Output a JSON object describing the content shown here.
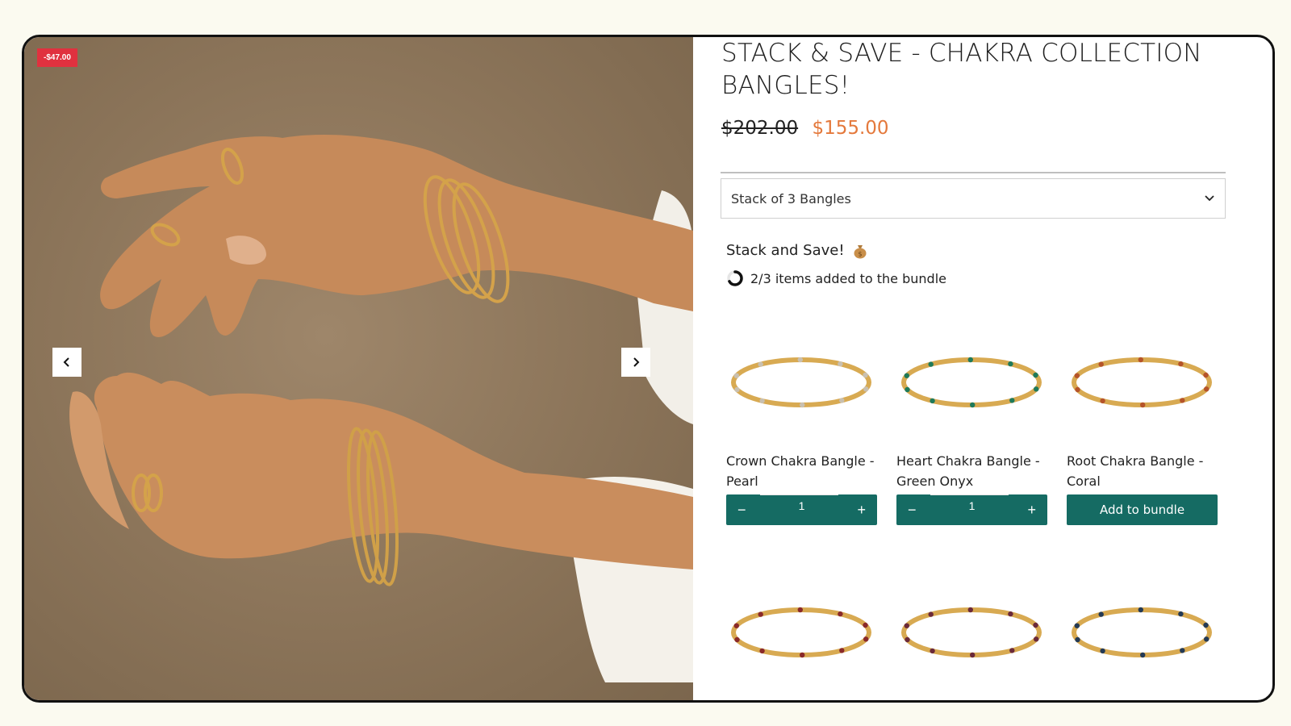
{
  "gallery": {
    "discount_badge": "-$47.00",
    "prev_icon": "chevron-left-icon",
    "next_icon": "chevron-right-icon"
  },
  "product": {
    "title": "STACK & SAVE - CHAKRA COLLECTION BANGLES!",
    "price_old": "$202.00",
    "price_new": "$155.00",
    "variant": "Stack of 3 Bangles",
    "variant_icon": "chevron-down-icon"
  },
  "bundle": {
    "heading": "Stack and Save!",
    "heading_icon": "money-bag-icon",
    "progress_text": "2/3 items added to the bundle",
    "progress_fraction": 0.6667
  },
  "items": [
    {
      "name": "Crown Chakra Bangle - Pearl",
      "qty": "1",
      "action": "stepper",
      "stone": "#c9c0b0"
    },
    {
      "name": "Heart Chakra Bangle - Green Onyx",
      "qty": "1",
      "action": "stepper",
      "stone": "#1f7a5a"
    },
    {
      "name": "Root Chakra Bangle - Coral",
      "qty": "",
      "action": "Add to bundle",
      "stone": "#b5542a"
    },
    {
      "name": "",
      "stone": "#8a2a2a"
    },
    {
      "name": "",
      "stone": "#6b2a3a"
    },
    {
      "name": "",
      "stone": "#243a55"
    }
  ],
  "colors": {
    "accent": "#156b63",
    "sale_price": "#e4793c",
    "badge": "#e0313f"
  }
}
